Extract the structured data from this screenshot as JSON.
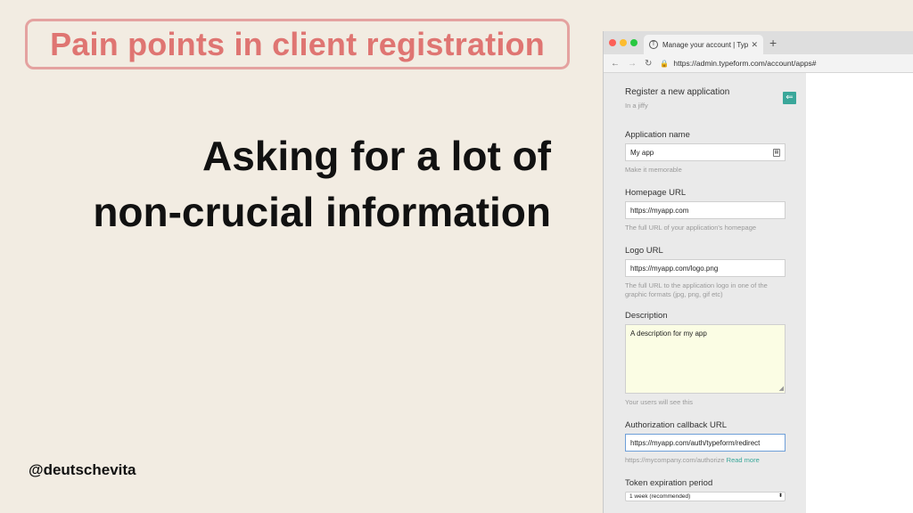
{
  "slide": {
    "title": "Pain points in client registration",
    "headline_line1": "Asking for a lot of",
    "headline_line2": "non-crucial information",
    "handle": "@deutschevita"
  },
  "browser": {
    "tab_title": "Manage your account | Typeform",
    "tab_favicon": "T",
    "url": "https://admin.typeform.com/account/apps#"
  },
  "form": {
    "title": "Register a new application",
    "subtitle": "In a jiffy",
    "fields": {
      "app_name": {
        "label": "Application name",
        "value": "My app",
        "hint": "Make it memorable"
      },
      "homepage": {
        "label": "Homepage URL",
        "value": "https://myapp.com",
        "hint": "The full URL of your application's homepage"
      },
      "logo": {
        "label": "Logo URL",
        "value": "https://myapp.com/logo.png",
        "hint": "The full URL to the application logo in one of the graphic formats (jpg, png, gif etc)"
      },
      "description": {
        "label": "Description",
        "value": "A description for my app",
        "hint": "Your users will see this"
      },
      "callback": {
        "label": "Authorization callback URL",
        "value": "https://myapp.com/auth/typeform/redirect",
        "hint": "https://mycompany.com/authorize",
        "hint_link": "Read more"
      },
      "token": {
        "label": "Token expiration period",
        "value": "1 week (recommended)"
      }
    }
  },
  "colors": {
    "accent": "#df7572",
    "teal": "#3aa79a",
    "background": "#f2ece2"
  }
}
